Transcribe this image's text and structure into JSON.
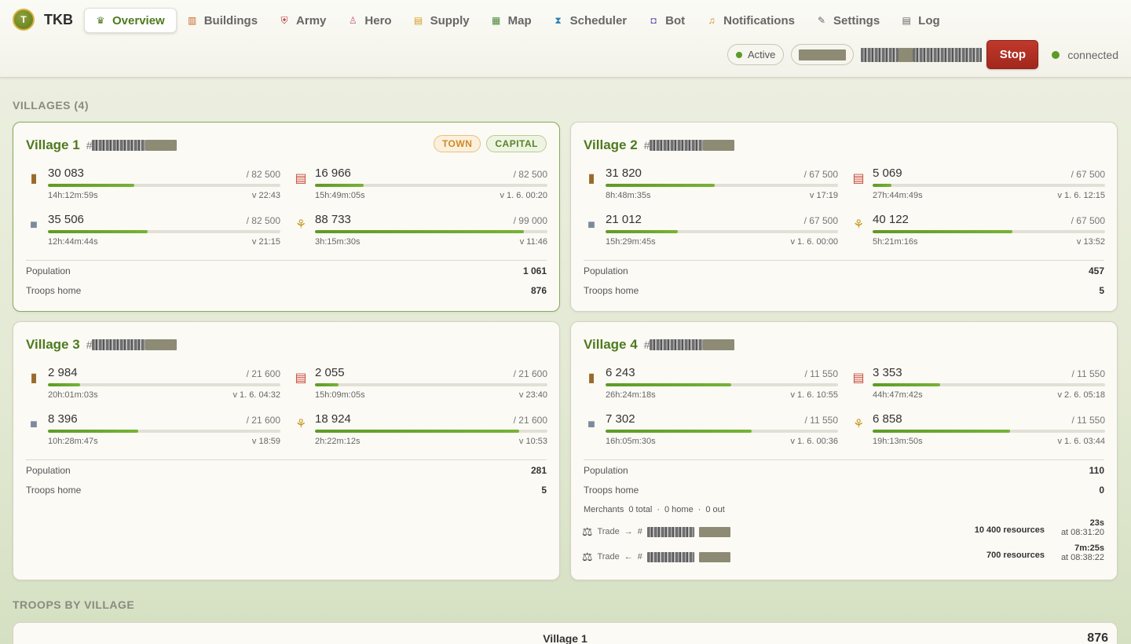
{
  "app": {
    "logo_letter": "T",
    "name": "TKB"
  },
  "nav": [
    {
      "label": "Overview",
      "icon": "crown-icon",
      "glyph": "♛",
      "color": "#4e7a1d",
      "active": true
    },
    {
      "label": "Buildings",
      "icon": "building-icon",
      "glyph": "▥",
      "color": "#c8662a"
    },
    {
      "label": "Army",
      "icon": "shield-icon",
      "glyph": "⛨",
      "color": "#b03030"
    },
    {
      "label": "Hero",
      "icon": "person-icon",
      "glyph": "♙",
      "color": "#c0607a"
    },
    {
      "label": "Supply",
      "icon": "wallet-icon",
      "glyph": "▤",
      "color": "#d4a020"
    },
    {
      "label": "Map",
      "icon": "map-icon",
      "glyph": "▦",
      "color": "#4e8a3a"
    },
    {
      "label": "Scheduler",
      "icon": "hourglass-icon",
      "glyph": "⧗",
      "color": "#2a7fb4"
    },
    {
      "label": "Bot",
      "icon": "robot-icon",
      "glyph": "◘",
      "color": "#6c5bb0"
    },
    {
      "label": "Notifications",
      "icon": "bell-icon",
      "glyph": "♫",
      "color": "#d08a1a"
    },
    {
      "label": "Settings",
      "icon": "wrench-icon",
      "glyph": "✎",
      "color": "#666666"
    },
    {
      "label": "Log",
      "icon": "document-icon",
      "glyph": "▤",
      "color": "#666666"
    }
  ],
  "status": {
    "active_label": "Active",
    "stop_label": "Stop",
    "connection_label": "connected"
  },
  "sections": {
    "villages": "VILLAGES (4)",
    "troops": "TROOPS BY VILLAGE"
  },
  "villages": [
    {
      "name": "Village 1",
      "hash": "#",
      "badges": [
        "TOWN",
        "CAPITAL"
      ],
      "resources": [
        {
          "type": "wood",
          "value": "30 083",
          "cap": "/ 82 500",
          "fill": 0.37,
          "time": "14h:12m:59s",
          "eta": "v 22:43"
        },
        {
          "type": "clay",
          "value": "16 966",
          "cap": "/ 82 500",
          "fill": 0.21,
          "time": "15h:49m:05s",
          "eta": "v 1. 6. 00:20"
        },
        {
          "type": "iron",
          "value": "35 506",
          "cap": "/ 82 500",
          "fill": 0.43,
          "time": "12h:44m:44s",
          "eta": "v 21:15"
        },
        {
          "type": "crop",
          "value": "88 733",
          "cap": "/ 99 000",
          "fill": 0.9,
          "time": "3h:15m:30s",
          "eta": "v 11:46"
        }
      ],
      "population_label": "Population",
      "population": "1 061",
      "troops_label": "Troops home",
      "troops": "876"
    },
    {
      "name": "Village 2",
      "hash": "#",
      "badges": [],
      "resources": [
        {
          "type": "wood",
          "value": "31 820",
          "cap": "/ 67 500",
          "fill": 0.47,
          "time": "8h:48m:35s",
          "eta": "v 17:19"
        },
        {
          "type": "clay",
          "value": "5 069",
          "cap": "/ 67 500",
          "fill": 0.08,
          "time": "27h:44m:49s",
          "eta": "v 1. 6. 12:15"
        },
        {
          "type": "iron",
          "value": "21 012",
          "cap": "/ 67 500",
          "fill": 0.31,
          "time": "15h:29m:45s",
          "eta": "v 1. 6. 00:00"
        },
        {
          "type": "crop",
          "value": "40 122",
          "cap": "/ 67 500",
          "fill": 0.6,
          "time": "5h:21m:16s",
          "eta": "v 13:52"
        }
      ],
      "population_label": "Population",
      "population": "457",
      "troops_label": "Troops home",
      "troops": "5"
    },
    {
      "name": "Village 3",
      "hash": "#",
      "badges": [],
      "resources": [
        {
          "type": "wood",
          "value": "2 984",
          "cap": "/ 21 600",
          "fill": 0.14,
          "time": "20h:01m:03s",
          "eta": "v 1. 6. 04:32"
        },
        {
          "type": "clay",
          "value": "2 055",
          "cap": "/ 21 600",
          "fill": 0.1,
          "time": "15h:09m:05s",
          "eta": "v 23:40"
        },
        {
          "type": "iron",
          "value": "8 396",
          "cap": "/ 21 600",
          "fill": 0.39,
          "time": "10h:28m:47s",
          "eta": "v 18:59"
        },
        {
          "type": "crop",
          "value": "18 924",
          "cap": "/ 21 600",
          "fill": 0.88,
          "time": "2h:22m:12s",
          "eta": "v 10:53"
        }
      ],
      "population_label": "Population",
      "population": "281",
      "troops_label": "Troops home",
      "troops": "5"
    },
    {
      "name": "Village 4",
      "hash": "#",
      "badges": [],
      "resources": [
        {
          "type": "wood",
          "value": "6 243",
          "cap": "/ 11 550",
          "fill": 0.54,
          "time": "26h:24m:18s",
          "eta": "v 1. 6. 10:55"
        },
        {
          "type": "clay",
          "value": "3 353",
          "cap": "/ 11 550",
          "fill": 0.29,
          "time": "44h:47m:42s",
          "eta": "v 2. 6. 05:18"
        },
        {
          "type": "iron",
          "value": "7 302",
          "cap": "/ 11 550",
          "fill": 0.63,
          "time": "16h:05m:30s",
          "eta": "v 1. 6. 00:36"
        },
        {
          "type": "crop",
          "value": "6 858",
          "cap": "/ 11 550",
          "fill": 0.59,
          "time": "19h:13m:50s",
          "eta": "v 1. 6. 03:44"
        }
      ],
      "population_label": "Population",
      "population": "110",
      "troops_label": "Troops home",
      "troops": "0",
      "merchants": {
        "label": "Merchants",
        "total": "0 total",
        "home": "0 home",
        "out": "0 out",
        "sep": "·"
      },
      "trades": [
        {
          "label": "Trade",
          "dir": "→",
          "hash": "#",
          "resources": "10 400 resources",
          "remaining": "23s",
          "at": "at 08:31:20"
        },
        {
          "label": "Trade",
          "dir": "←",
          "hash": "#",
          "resources": "700 resources",
          "remaining": "7m:25s",
          "at": "at 08:38:22"
        }
      ]
    }
  ],
  "troops_by_village": [
    {
      "name": "Village 1",
      "count": "876"
    }
  ],
  "colors": {
    "accent": "#4e7a1d",
    "stop": "#b03024",
    "connected": "#5e9a26",
    "bar": "#6aa62c"
  }
}
